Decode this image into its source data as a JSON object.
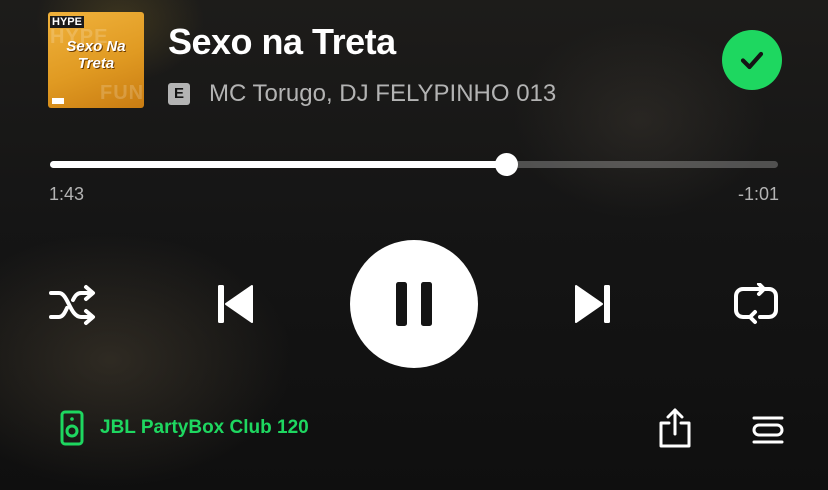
{
  "track": {
    "title": "Sexo na Treta",
    "explicit_badge": "E",
    "artists": "MC Torugo, DJ FELYPINHO 013",
    "liked": true
  },
  "cover_art": {
    "tag": "HYPE",
    "title_line1": "Sexo Na",
    "title_line2": "Treta"
  },
  "playback": {
    "elapsed": "1:43",
    "remaining": "-1:01",
    "progress_fraction": 0.626,
    "state": "playing"
  },
  "controls": {
    "shuffle_icon": "shuffle-icon",
    "previous_icon": "skip-previous-icon",
    "pause_icon": "pause-icon",
    "next_icon": "skip-next-icon",
    "repeat_icon": "repeat-icon"
  },
  "footer": {
    "device_name": "JBL PartyBox Club 120",
    "device_icon": "speaker-icon",
    "share_icon": "share-icon",
    "queue_icon": "queue-icon"
  },
  "colors": {
    "accent": "#1ed760",
    "text_secondary": "#b3b3b3",
    "background": "#141414"
  }
}
